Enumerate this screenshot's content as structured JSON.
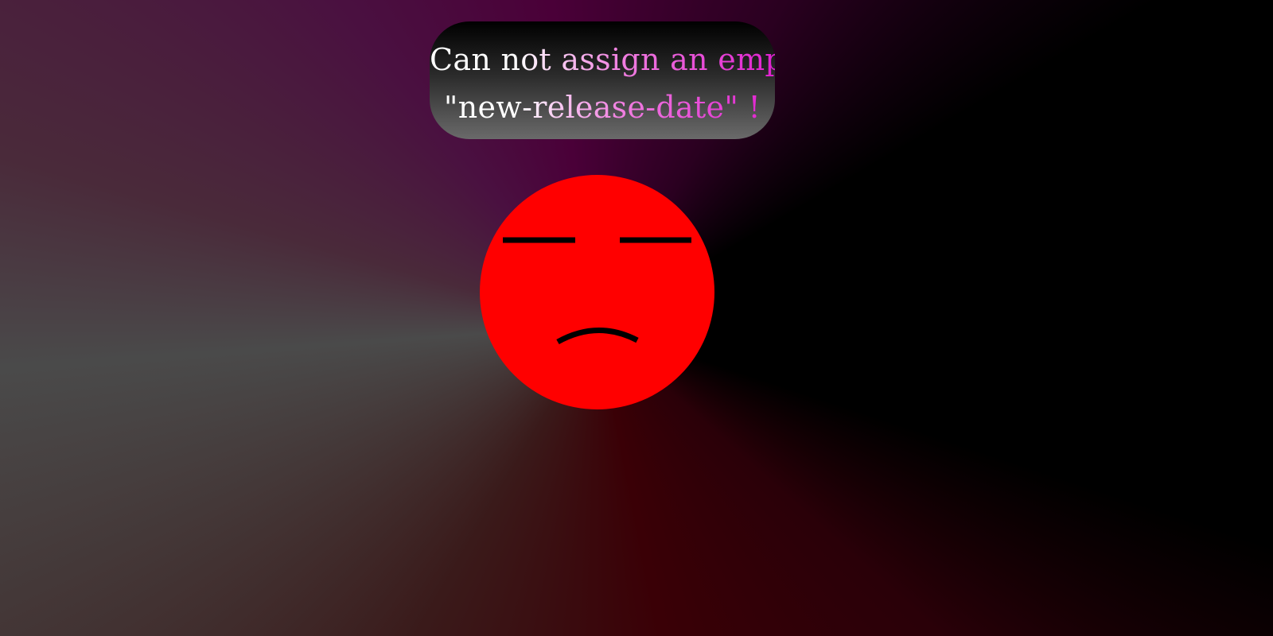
{
  "error_dialog": {
    "message_line_1": "Can not assign an empty",
    "message_line_2": "\"new-release-date\" !"
  },
  "face": {
    "icon": "sad-face-icon",
    "color": "#ff0000",
    "feature_color": "#000000"
  }
}
